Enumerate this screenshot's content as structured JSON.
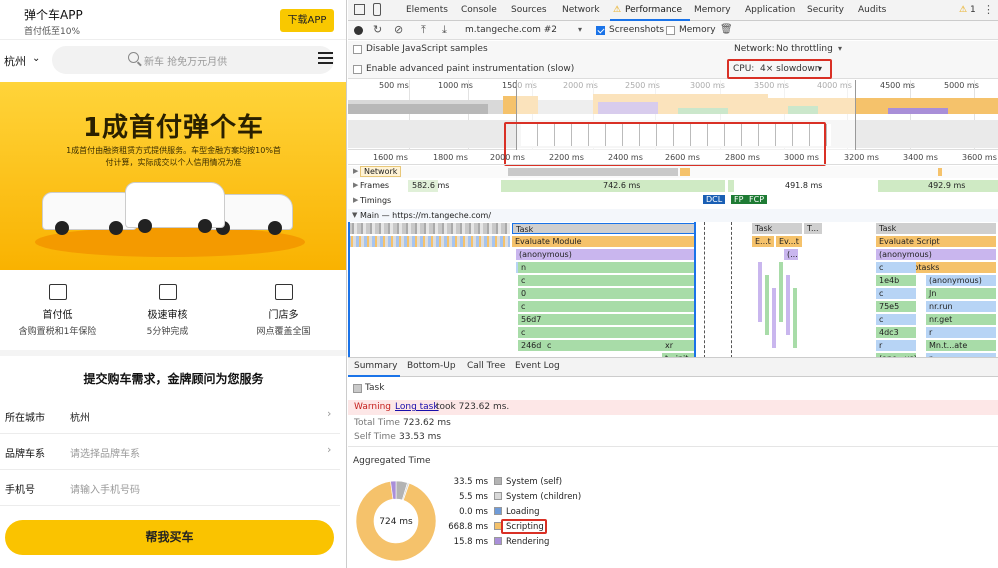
{
  "mobile": {
    "app_title": "弹个车APP",
    "app_subtitle": "首付低至10%",
    "download_label": "下载APP",
    "city": "杭州",
    "search_placeholder": "新车 抢免万元月供",
    "banner_headline": "1成首付弹个车",
    "banner_sub1": "1成首付由融资租赁方式提供服务。车型金融方案均按10%首",
    "banner_sub2": "付计算，实际成交以个人信用情况为准",
    "features": [
      {
        "title": "首付低",
        "desc": "含购置税和1年保险"
      },
      {
        "title": "极速审核",
        "desc": "5分钟完成"
      },
      {
        "title": "门店多",
        "desc": "网点覆盖全国"
      }
    ],
    "form_title": "提交购车需求，金牌顾问为您服务",
    "form_rows": [
      {
        "label": "所在城市",
        "value": "杭州"
      },
      {
        "label": "品牌车系",
        "value": "请选择品牌车系"
      },
      {
        "label": "手机号",
        "value": "请输入手机号码"
      }
    ],
    "submit_label": "帮我买车"
  },
  "devtools": {
    "tabs": [
      "Elements",
      "Console",
      "Sources",
      "Network",
      "Performance",
      "Memory",
      "Application",
      "Security",
      "Audits"
    ],
    "active_tab": "Performance",
    "warning_count": "1",
    "target": "m.tangeche.com #2",
    "screenshots_label": "Screenshots",
    "memory_label": "Memory",
    "disable_js_samples": "Disable JavaScript samples",
    "advanced_paint": "Enable advanced paint instrumentation (slow)",
    "network_label": "Network:",
    "network_value": "No throttling",
    "cpu_label": "CPU:",
    "cpu_value": "4× slowdown",
    "overview_ticks": [
      "500 ms",
      "1000 ms",
      "1500 ms",
      "2000 ms",
      "2500 ms",
      "3000 ms",
      "3500 ms",
      "4000 ms",
      "4500 ms",
      "5000 ms"
    ],
    "ruler_ticks": [
      "1600 ms",
      "1800 ms",
      "2000 ms",
      "2200 ms",
      "2400 ms",
      "2600 ms",
      "2800 ms",
      "3000 ms",
      "3200 ms",
      "3400 ms",
      "3600 ms"
    ],
    "tracks": {
      "network": "Network",
      "frames": "Frames",
      "frame_times": [
        "582.6 ms",
        "742.6 ms",
        "491.8 ms",
        "492.9 ms"
      ],
      "timings": "Timings",
      "markers": [
        "DCL",
        "FP",
        "FCP"
      ],
      "main": "Main — https://m.tangeche.com/"
    },
    "flame_left": [
      "Task",
      "Evaluate Module",
      "(anonymous)",
      "(anonymous)",
      "n",
      "c",
      "0",
      "c",
      "56d7",
      "c",
      "246d"
    ],
    "flame_left_extra": [
      "c",
      "xr",
      "t...init"
    ],
    "flame_mid": [
      "Task",
      "T...",
      "E...t",
      "Ev...t",
      "(..."
    ],
    "flame_right": [
      "Task",
      "Evaluate Script",
      "(anonymous)",
      "Run Microtasks",
      "c",
      "1e4b",
      "c",
      "75e5",
      "c",
      "4dc3",
      "r",
      "(ano...us)"
    ],
    "flame_right2": [
      "(anonymous)",
      "Jn",
      "nr.run",
      "nr.get",
      "r",
      "Mn.t...ate",
      "r"
    ],
    "bottom_tabs": [
      "Summary",
      "Bottom-Up",
      "Call Tree",
      "Event Log"
    ],
    "summary": {
      "task_label": "Task",
      "warning_label": "Warning",
      "warning_link": "Long task",
      "warning_text": "took 723.62 ms.",
      "total_label": "Total Time",
      "total_value": "723.62 ms",
      "self_label": "Self Time",
      "self_value": "33.53 ms",
      "aggregated_title": "Aggregated Time",
      "donut_center": "724 ms",
      "breakdown": [
        {
          "value": "33.5 ms",
          "label": "System (self)",
          "color": "#b3b3b3"
        },
        {
          "value": "5.5 ms",
          "label": "System (children)",
          "color": "#d9d9d9"
        },
        {
          "value": "0.0 ms",
          "label": "Loading",
          "color": "#6f9bd8"
        },
        {
          "value": "668.8 ms",
          "label": "Scripting",
          "color": "#f5c26b"
        },
        {
          "value": "15.8 ms",
          "label": "Rendering",
          "color": "#a98fd8"
        }
      ]
    }
  }
}
